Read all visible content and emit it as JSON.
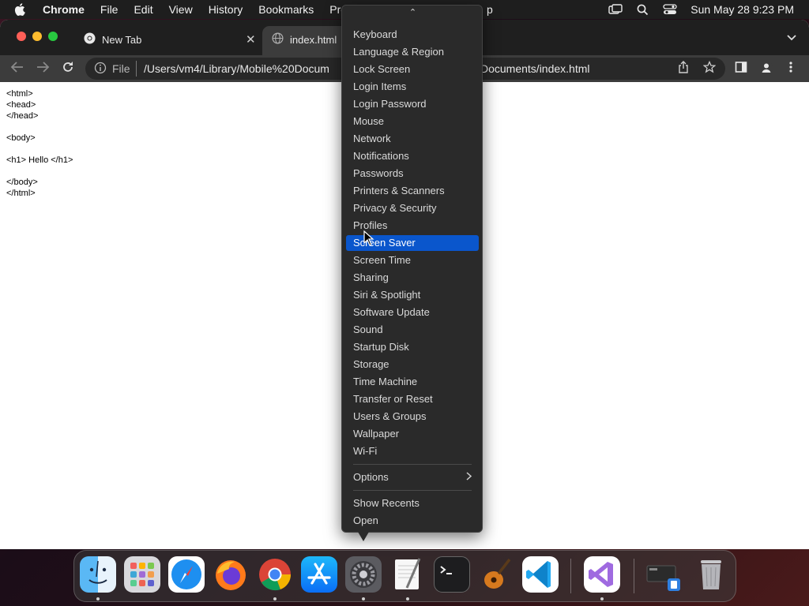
{
  "menubar": {
    "app_name": "Chrome",
    "items": [
      "File",
      "Edit",
      "View",
      "History",
      "Bookmarks",
      "Pro",
      "p"
    ],
    "clock": "Sun May 28  9:23 PM"
  },
  "browser": {
    "tabs": [
      {
        "title": "New Tab",
        "close": "✕"
      },
      {
        "title": "index.html"
      }
    ],
    "omnibox": {
      "scheme": "File",
      "url": "/Users/vm4/Library/Mobile%20Docum",
      "url_tail": "Documents/index.html"
    },
    "page_text": "<html>\n<head>\n</head>\n\n<body>\n\n<h1> Hello </h1>\n\n</body>\n</html>"
  },
  "context_menu": {
    "scroll_indicator": "⌃",
    "items": [
      "Keyboard",
      "Language & Region",
      "Lock Screen",
      "Login Items",
      "Login Password",
      "Mouse",
      "Network",
      "Notifications",
      "Passwords",
      "Printers & Scanners",
      "Privacy & Security",
      "Profiles",
      "Screen Saver",
      "Screen Time",
      "Sharing",
      "Siri & Spotlight",
      "Software Update",
      "Sound",
      "Startup Disk",
      "Storage",
      "Time Machine",
      "Transfer or Reset",
      "Users & Groups",
      "Wallpaper",
      "Wi-Fi"
    ],
    "selected": "Screen Saver",
    "options_label": "Options",
    "show_recents_label": "Show Recents",
    "open_label": "Open"
  },
  "dock": {
    "apps": [
      "finder",
      "launchpad",
      "safari",
      "firefox",
      "chrome",
      "app-store",
      "system-settings",
      "textedit",
      "terminal",
      "garageband",
      "vscode",
      "visual-studio",
      "downloads",
      "trash"
    ]
  },
  "colors": {
    "menu_highlight": "#0a56cc",
    "menubar": "#1e1e1e"
  }
}
